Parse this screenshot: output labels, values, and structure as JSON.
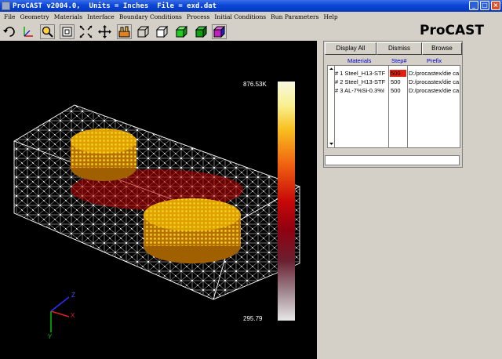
{
  "window": {
    "title": "ProCAST v2004.0,  Units = Inches  File = exd.dat",
    "buttons": [
      "_",
      "□",
      "×"
    ]
  },
  "menu": [
    "File",
    "Geometry",
    "Materials",
    "Interface",
    "Boundary Conditions",
    "Process",
    "Initial Conditions",
    "Run Parameters",
    "Help"
  ],
  "toolbar": {
    "brand": "ProCAST",
    "tools": [
      "rotate-icon",
      "axes-icon",
      "zoom-icon",
      "zoom-box-icon",
      "fit-icon",
      "pan-icon",
      "mesh-view-icon",
      "wireframe-icon",
      "box-icon",
      "solid-green-icon",
      "solid-green-2-icon",
      "material-color-icon"
    ]
  },
  "viewport": {
    "scale_max": "876.53K",
    "scale_min": "295.79",
    "axes": {
      "x": "X",
      "y": "Y",
      "z": "Z"
    },
    "colors": {
      "background": "#000000",
      "mesh": "#ffffff"
    }
  },
  "panel": {
    "buttons": {
      "display_all": "Display All",
      "dismiss": "Dismiss",
      "browse": "Browse"
    },
    "columns": {
      "materials": "Materials",
      "step": "Step#",
      "prefix": "Prefix"
    },
    "rows": [
      {
        "material": "# 1 Steel_H13-STF",
        "step": "500",
        "prefix": "D:/procastex/die ca",
        "selected": true
      },
      {
        "material": "# 2 Steel_H13-STF",
        "step": "500",
        "prefix": "D:/procastex/die ca",
        "selected": false
      },
      {
        "material": "# 3 AL-7%Si-0.3%I",
        "step": "500",
        "prefix": "D:/procastex/die ca",
        "selected": false
      }
    ]
  }
}
